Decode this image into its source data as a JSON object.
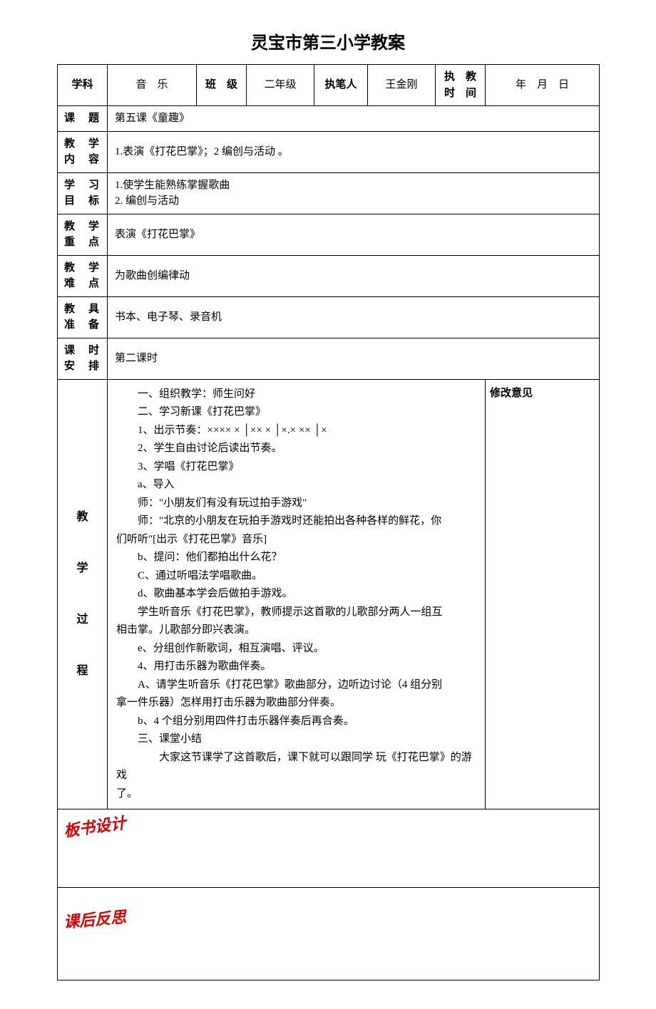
{
  "title": "灵宝市第三小学教案",
  "header": {
    "subject_label": "学科",
    "subject_value": "音　乐",
    "class_label": "班　级",
    "class_value": "二年级",
    "writer_label": "执笔人",
    "writer_value": "王金刚",
    "time_label": "执　教时　间",
    "time_value": "年　月　日"
  },
  "rows": {
    "topic_label": "课　题",
    "topic_value": "第五课《童趣》",
    "content_label": "教　学内　容",
    "content_value": "1.表演《打花巴掌》；2 编创与活动 。",
    "objective_label": "学　习目　标",
    "objective_line1": "1.使学生能熟练掌握歌曲",
    "objective_line2": "2. 编创与活动",
    "keypoint_label": "教　学重　点",
    "keypoint_value": "表演《打花巴掌》",
    "difficulty_label": "教　学难　点",
    "difficulty_value": "为歌曲创编律动",
    "tools_label": "教　具准　备",
    "tools_value": "书本、电子琴、录音机",
    "period_label": "课　时安　排",
    "period_value": "第二课时"
  },
  "process": {
    "label1": "教",
    "label2": "学",
    "label3": "过",
    "label4": "程",
    "revision_label": "修改意见",
    "lines": [
      "一、组织教学：师生问好",
      "二、学习新课《打花巴掌》",
      "1、出示节奏：×××× × │×× × │×.× ×× │×",
      "2、学生自由讨论后读出节奏。",
      "3、学唱《打花巴掌》",
      "a、导入",
      "师：\"小朋友们有没有玩过拍手游戏\"",
      "师：\"北京的小朋友在玩拍手游戏时还能拍出各种各样的鲜花，你",
      "们听听\"[出示《打花巴掌》音乐]",
      "b、提问：他们都拍出什么花？",
      "C、通过听唱法学唱歌曲。",
      "d、歌曲基本学会后做拍手游戏。",
      "学生听音乐《打花巴掌》，教师提示这首歌的儿歌部分两人一组互",
      "相击掌。儿歌部分即兴表演。",
      "e、分组创作新歌词，相互演唱、评议。",
      "4、用打击乐器为歌曲伴奏。",
      "A、请学生听音乐《打花巴掌》歌曲部分，边听边讨论（4 组分别",
      "拿一件乐器）怎样用打击乐器为歌曲部分伴奏。",
      "b、4 个组分别用四件打击乐器伴奏后再合奏。",
      "三、课堂小结",
      "　　大家这节课学了这首歌后，课下就可以跟同学 玩《打花巴掌》的游戏",
      "了。"
    ]
  },
  "footer": {
    "design_label": "板书设计",
    "reflection_label": "课后反思"
  }
}
